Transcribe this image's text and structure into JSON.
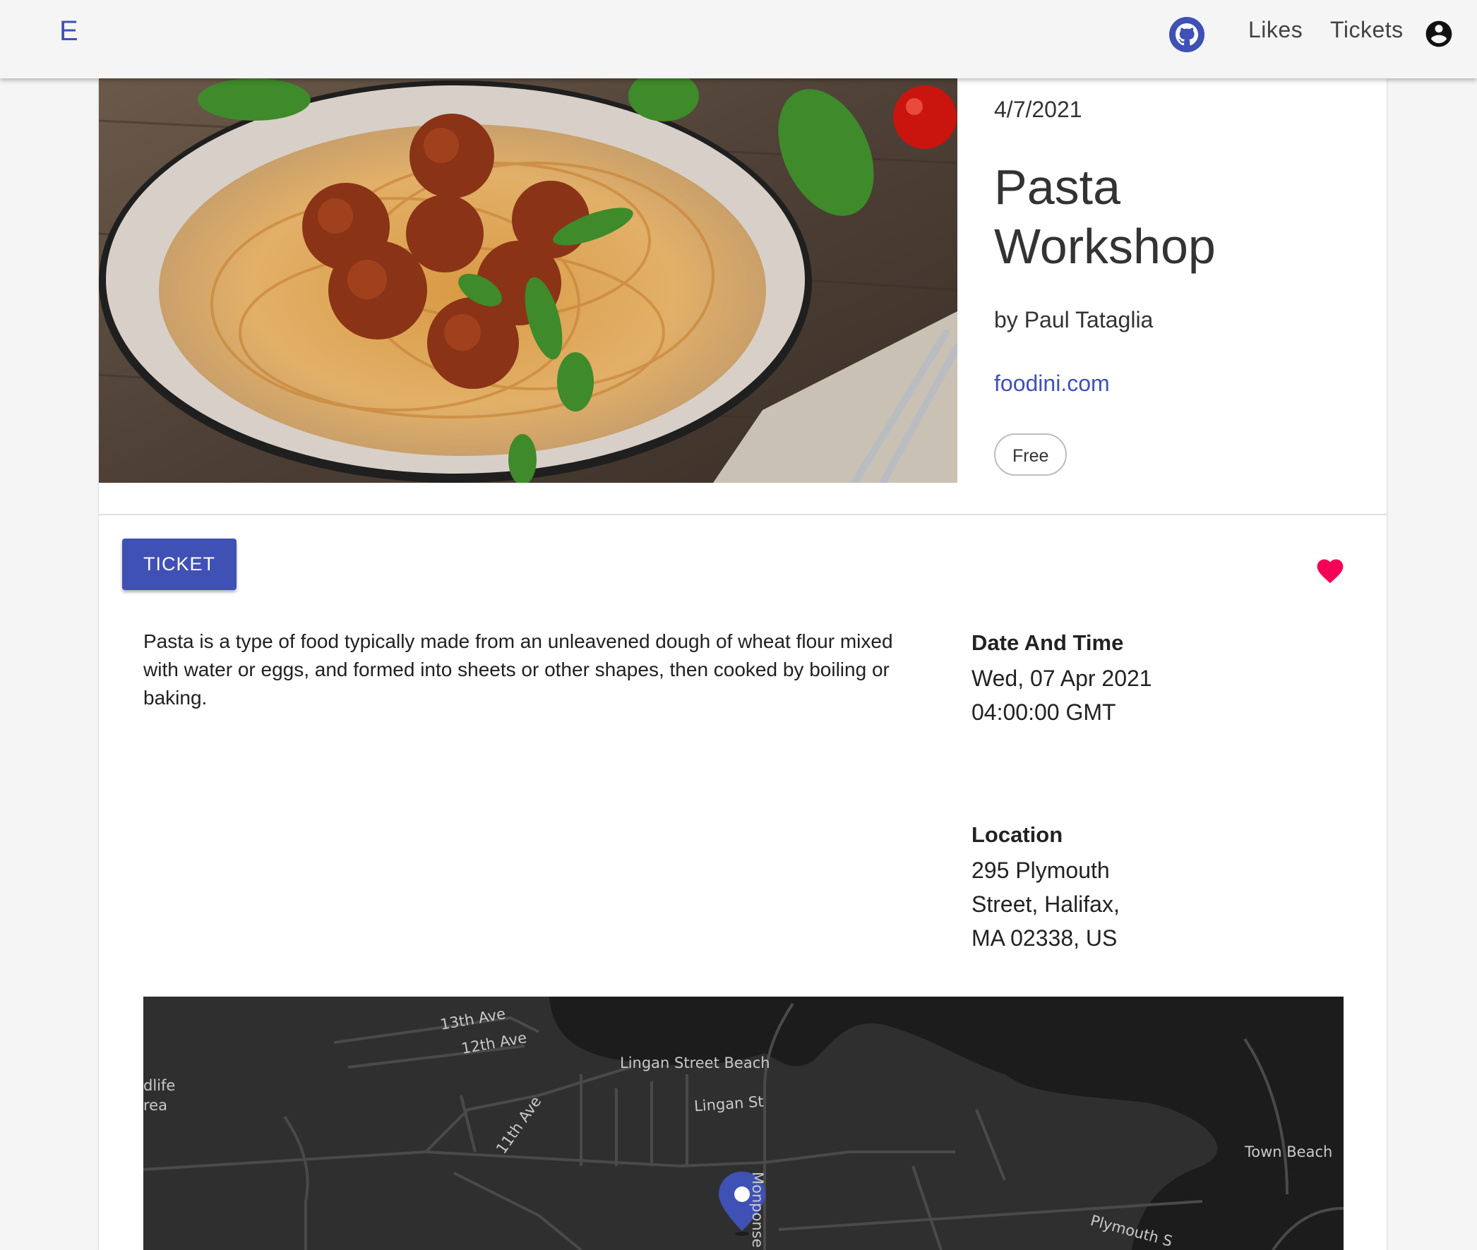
{
  "header": {
    "logo": "E",
    "github_icon": "github-icon",
    "nav": {
      "likes": "Likes",
      "tickets": "Tickets"
    },
    "account_icon": "account-circle-icon"
  },
  "event": {
    "date_short": "4/7/2021",
    "title": "Pasta Workshop",
    "organizer": "by Paul Tataglia",
    "website": "foodini.com",
    "price_chip": "Free",
    "ticket_button": "TICKET",
    "liked": true,
    "description": "Pasta is a type of food typically made from an unleavened dough of wheat flour mixed with water or eggs, and formed into sheets or other shapes, then cooked by boiling or baking.",
    "date_time_label": "Date And Time",
    "date_time_value": "Wed, 07 Apr 2021 04:00:00 GMT",
    "location_label": "Location",
    "location_value": "295 Plymouth Street, Halifax, MA 02338, US"
  },
  "map": {
    "labels": {
      "ave13": "13th Ave",
      "ave12": "12th Ave",
      "ave11": "11th Ave",
      "beach": "Lingan Street Beach",
      "lingan_st": "Lingan St",
      "wildlife": "dlife",
      "area": "rea",
      "town_beach": "Town Beach",
      "monponsett": "Monponse",
      "plymouth": "Plymouth S"
    }
  },
  "colors": {
    "primary": "#3f51b5",
    "heart": "#f50057",
    "map_land": "#2f2f2f",
    "map_water": "#1b1c1b"
  }
}
